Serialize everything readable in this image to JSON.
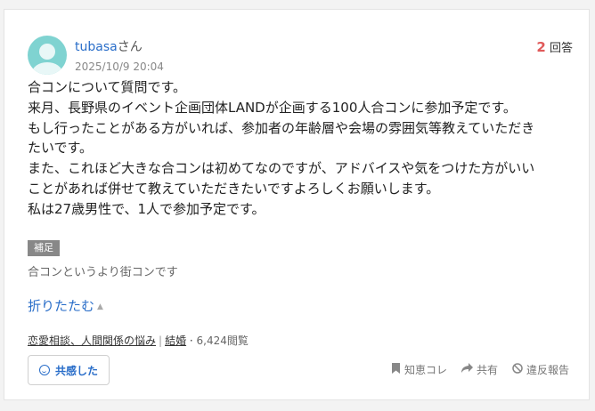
{
  "user": {
    "name": "tubasa",
    "honorific": "さん",
    "date": "2025/10/9 20:04"
  },
  "answers": {
    "count": "2",
    "label": "回答"
  },
  "question": {
    "lines": [
      "合コンについて質問です。",
      "来月、長野県のイベント企画団体LANDが企画する100人合コンに参加予定です。",
      "もし行ったことがある方がいれば、参加者の年齢層や会場の雰囲気等教えていただき",
      "たいです。",
      "また、これほど大きな合コンは初めてなのですが、アドバイスや気をつけた方がいい",
      "ことがあれば併せて教えていただきたいですよろしくお願いします。",
      "私は27歳男性で、1人で参加予定です。"
    ]
  },
  "supplement": {
    "tag": "補足",
    "text": "合コンというより街コンです"
  },
  "collapse_label": "折りたたむ",
  "category": {
    "items": [
      "恋愛相談、人間関係の悩み",
      "結婚"
    ],
    "views": "6,424閲覧"
  },
  "empathy_label": "共感した",
  "actions": {
    "bookmark": "知恵コレ",
    "share": "共有",
    "report": "違反報告"
  },
  "icons": {
    "avatar": "default-user-avatar",
    "bookmark": "bookmark-icon",
    "share": "share-arrow-icon",
    "report": "prohibit-icon",
    "empathy": "smile-icon"
  },
  "colors": {
    "link": "#2a6ec9",
    "answer_count": "#e05a5a",
    "avatar": "#7fd3d1"
  }
}
